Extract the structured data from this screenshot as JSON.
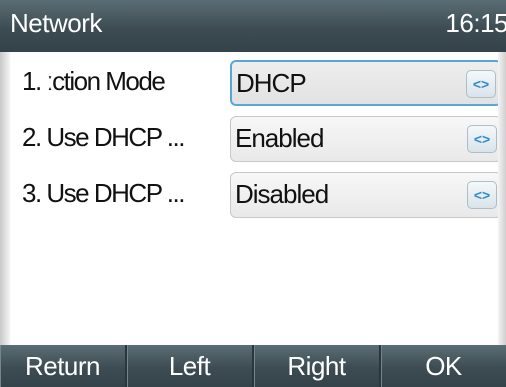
{
  "header": {
    "title": "Network",
    "clock": "16:15"
  },
  "settings": [
    {
      "label": "1. ːction Mode",
      "value": "DHCP",
      "selected": true
    },
    {
      "label": "2. Use DHCP ...",
      "value": "Enabled",
      "selected": false
    },
    {
      "label": "3. Use DHCP ...",
      "value": "Disabled",
      "selected": false
    }
  ],
  "arrow_glyph": "<>",
  "softkeys": {
    "return": "Return",
    "left": "Left",
    "right": "Right",
    "ok": "OK"
  },
  "colors": {
    "header_bar": "#3d4c53",
    "selection_border": "#5aa6d6",
    "arrow_blue": "#2f8bc9"
  }
}
